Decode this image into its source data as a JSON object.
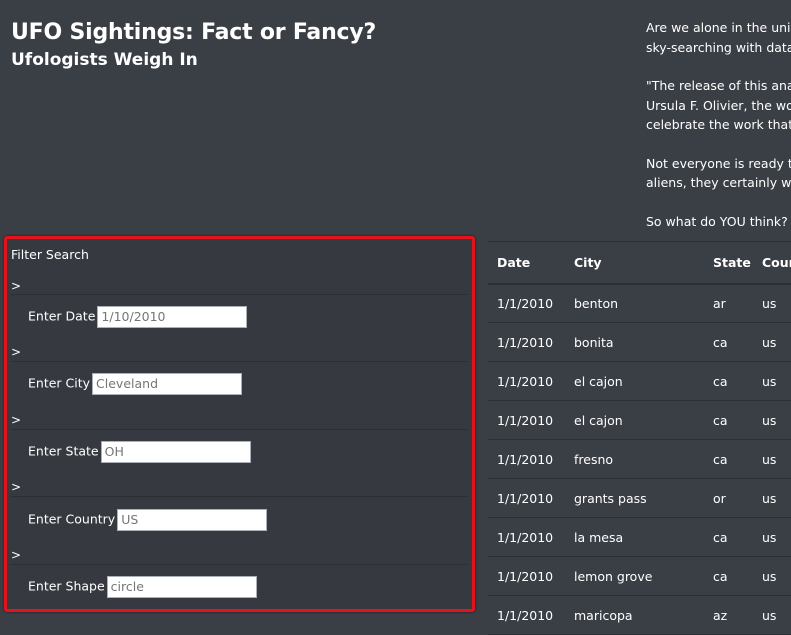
{
  "header": {
    "title": "UFO Sightings: Fact or Fancy?",
    "subtitle": "Ufologists Weigh In"
  },
  "article": {
    "paragraphs": [
      [
        "Are we alone in the univer",
        "sky-searching with data ar"
      ],
      [
        "\"The release of this analys",
        "Ursula F. Olivier, the world",
        "celebrate the work that ha"
      ],
      [
        "Not everyone is ready to c",
        "aliens, they certainly woul"
      ],
      [
        "So what do YOU think? Ar"
      ]
    ]
  },
  "filters": {
    "title": "Filter Search",
    "caret": ">",
    "fields": [
      {
        "label": "Enter Date",
        "placeholder": "1/10/2010"
      },
      {
        "label": "Enter City",
        "placeholder": "Cleveland"
      },
      {
        "label": "Enter State",
        "placeholder": "OH"
      },
      {
        "label": "Enter Country",
        "placeholder": "US"
      },
      {
        "label": "Enter Shape",
        "placeholder": "circle"
      }
    ]
  },
  "table": {
    "headers": [
      "Date",
      "City",
      "State",
      "Coun"
    ],
    "rows": [
      [
        "1/1/2010",
        "benton",
        "ar",
        "us"
      ],
      [
        "1/1/2010",
        "bonita",
        "ca",
        "us"
      ],
      [
        "1/1/2010",
        "el cajon",
        "ca",
        "us"
      ],
      [
        "1/1/2010",
        "el cajon",
        "ca",
        "us"
      ],
      [
        "1/1/2010",
        "fresno",
        "ca",
        "us"
      ],
      [
        "1/1/2010",
        "grants pass",
        "or",
        "us"
      ],
      [
        "1/1/2010",
        "la mesa",
        "ca",
        "us"
      ],
      [
        "1/1/2010",
        "lemon grove",
        "ca",
        "us"
      ],
      [
        "1/1/2010",
        "maricopa",
        "az",
        "us"
      ]
    ]
  },
  "colors": {
    "background": "#3a3e45",
    "panel_border": "#e0141a",
    "text": "#ffffff"
  }
}
